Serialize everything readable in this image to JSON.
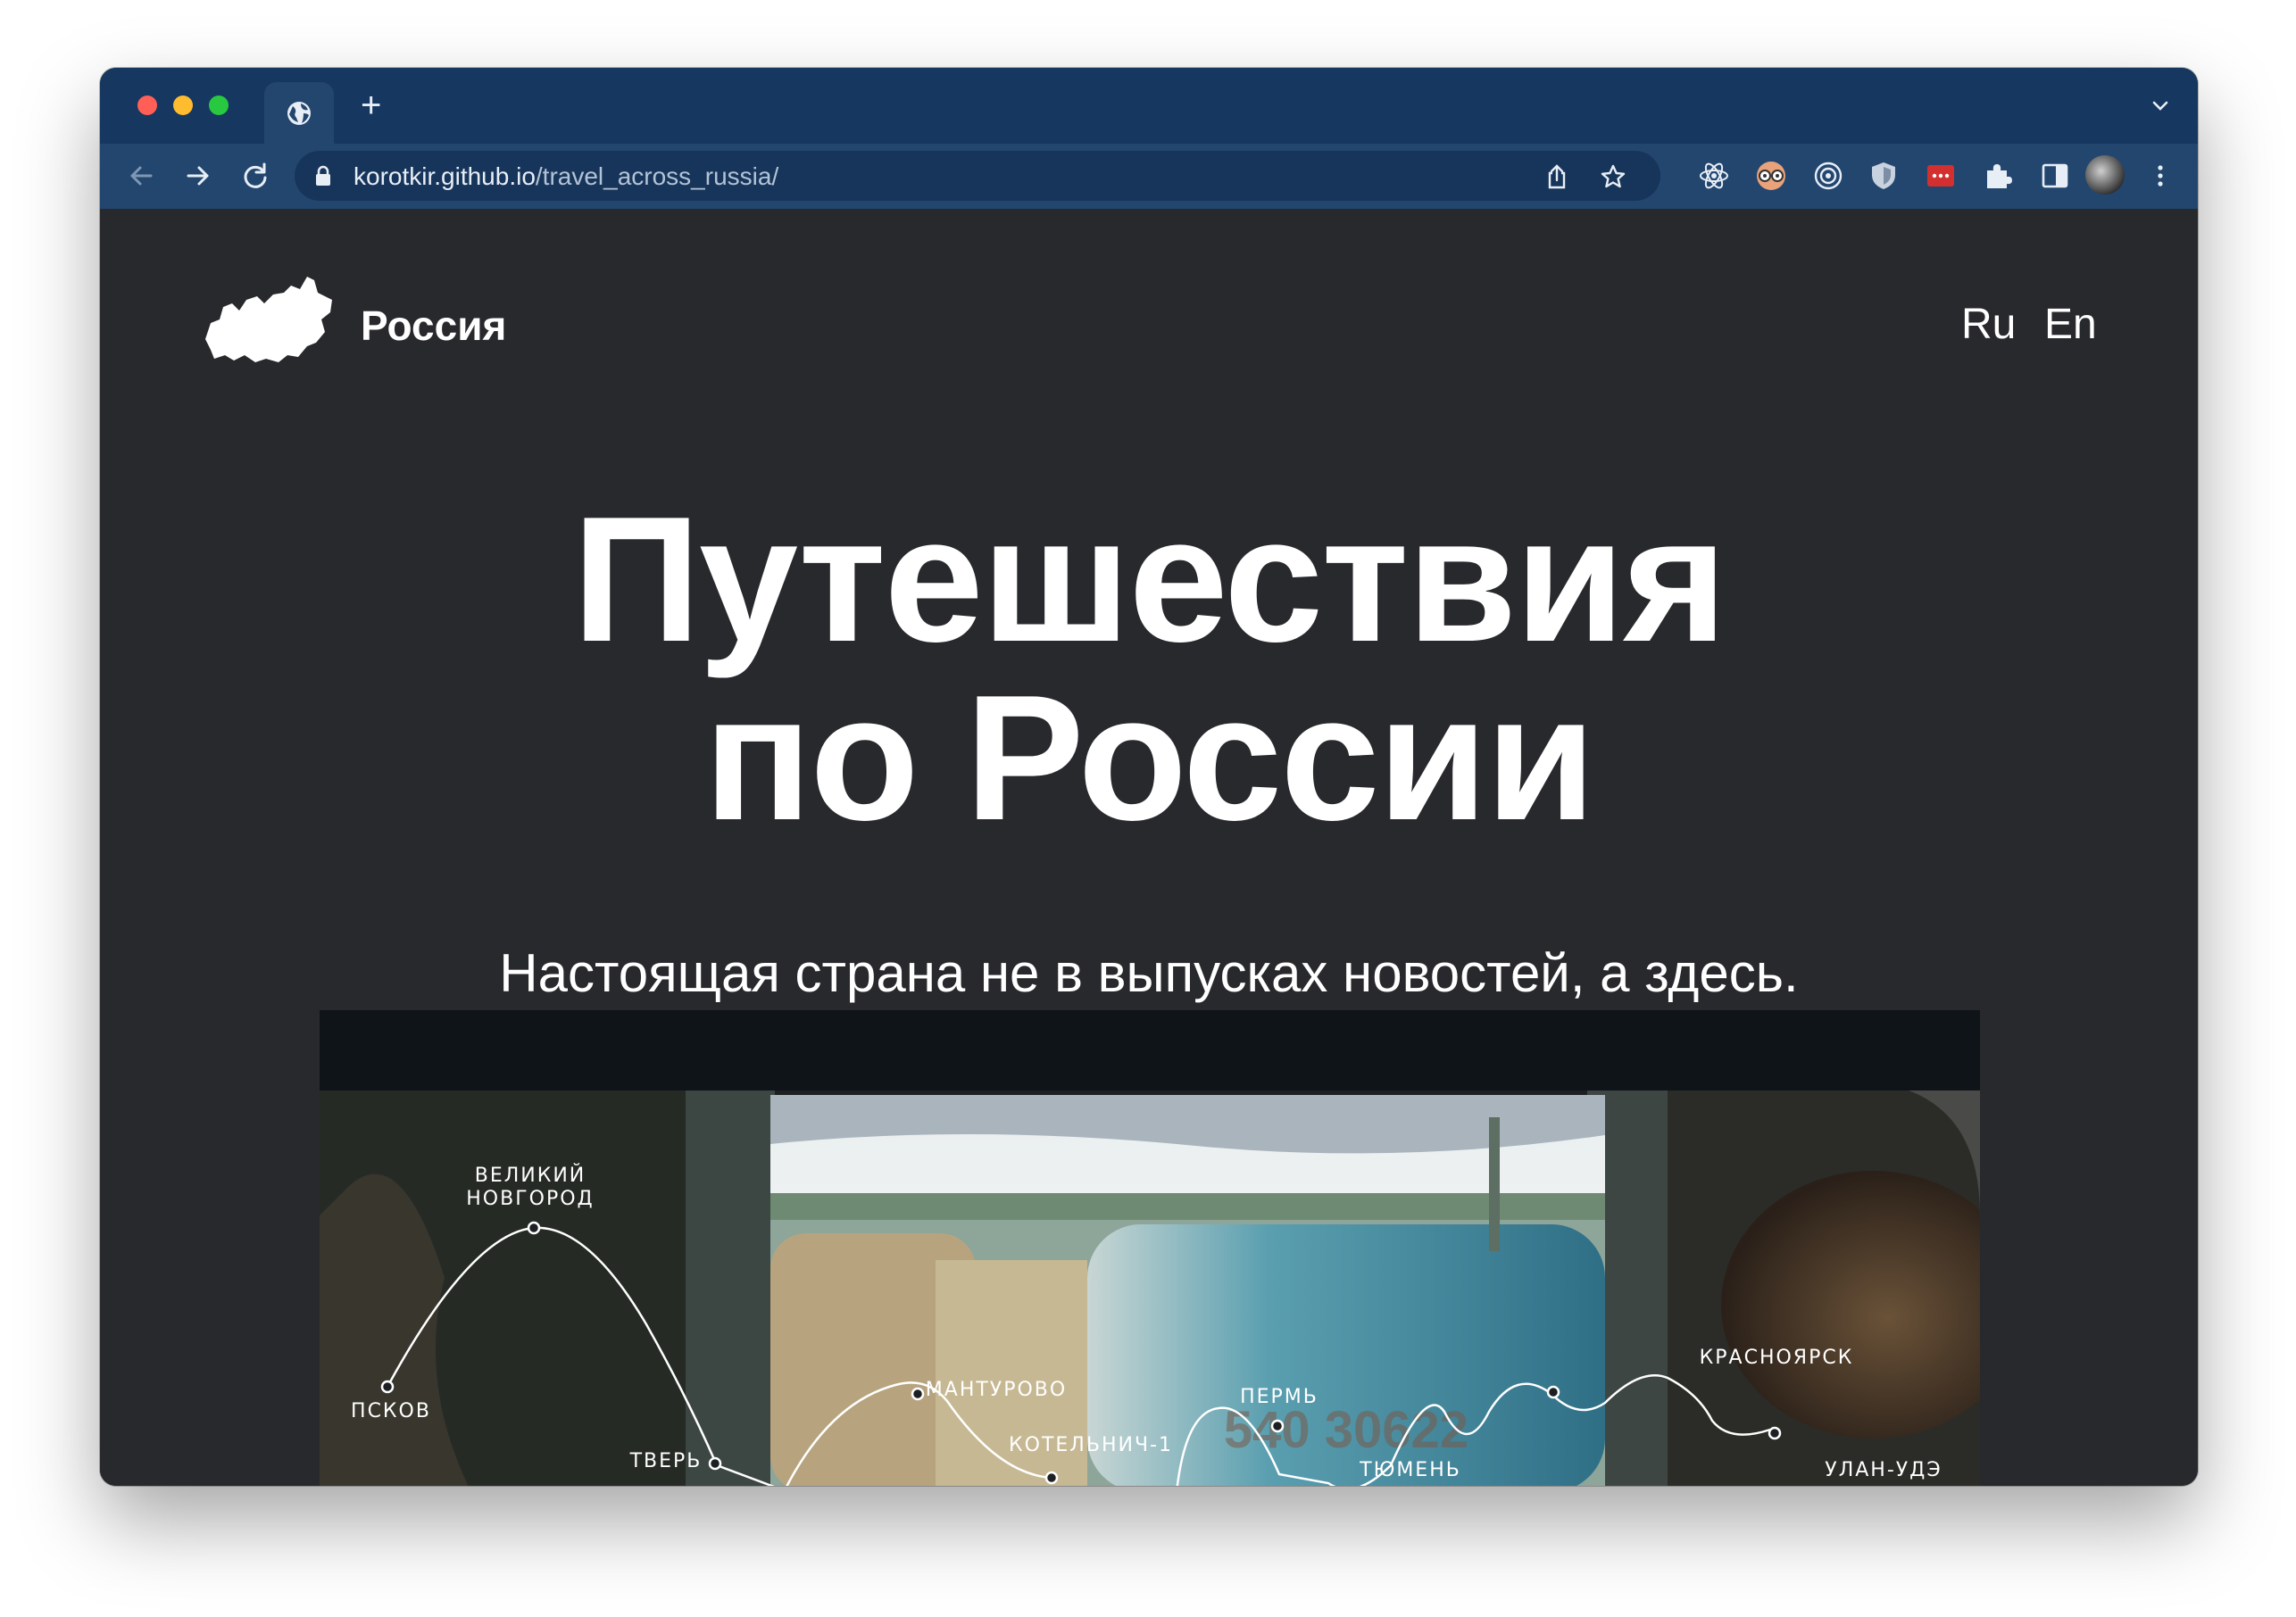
{
  "browser": {
    "url_host": "korotkir.github.io",
    "url_path": "/travel_across_russia/",
    "new_tab_label": "+"
  },
  "site": {
    "brand": "Россия",
    "languages": [
      "Ru",
      "En"
    ],
    "hero_line1": "Путешествия",
    "hero_line2": "по России",
    "tagline": "Настоящая страна не в выпусках новостей, а здесь."
  },
  "route_stops": [
    {
      "name_line1": "ВЕЛИКИЙ",
      "name_line2": "НОВГОРОД"
    },
    {
      "name_line1": "ПСКОВ"
    },
    {
      "name_line1": "ТВЕРЬ"
    },
    {
      "name_line1": "МАНТУРОВО"
    },
    {
      "name_line1": "КОТЕЛЬНИЧ-1"
    },
    {
      "name_line1": "ПЕРМЬ"
    },
    {
      "name_line1": "ТЮМЕНЬ"
    },
    {
      "name_line1": "КРАСНОЯРСК"
    },
    {
      "name_line1": "УЛАН-УДЭ"
    }
  ],
  "photo_overlay_text": "540 30622",
  "icons": [
    "globe-icon",
    "back-icon",
    "forward-icon",
    "reload-icon",
    "lock-icon",
    "share-icon",
    "star-icon",
    "react-devtools-icon",
    "glasses-icon",
    "target-icon",
    "shield-icon",
    "password-manager-icon",
    "puzzle-icon",
    "side-panel-icon",
    "profile-avatar",
    "more-menu-icon",
    "russia-map-logo"
  ],
  "colors": {
    "tab_strip": "#163760",
    "toolbar": "#23466f",
    "omnibox": "#17355b",
    "page_bg": "#28292d",
    "text": "#ffffff"
  }
}
